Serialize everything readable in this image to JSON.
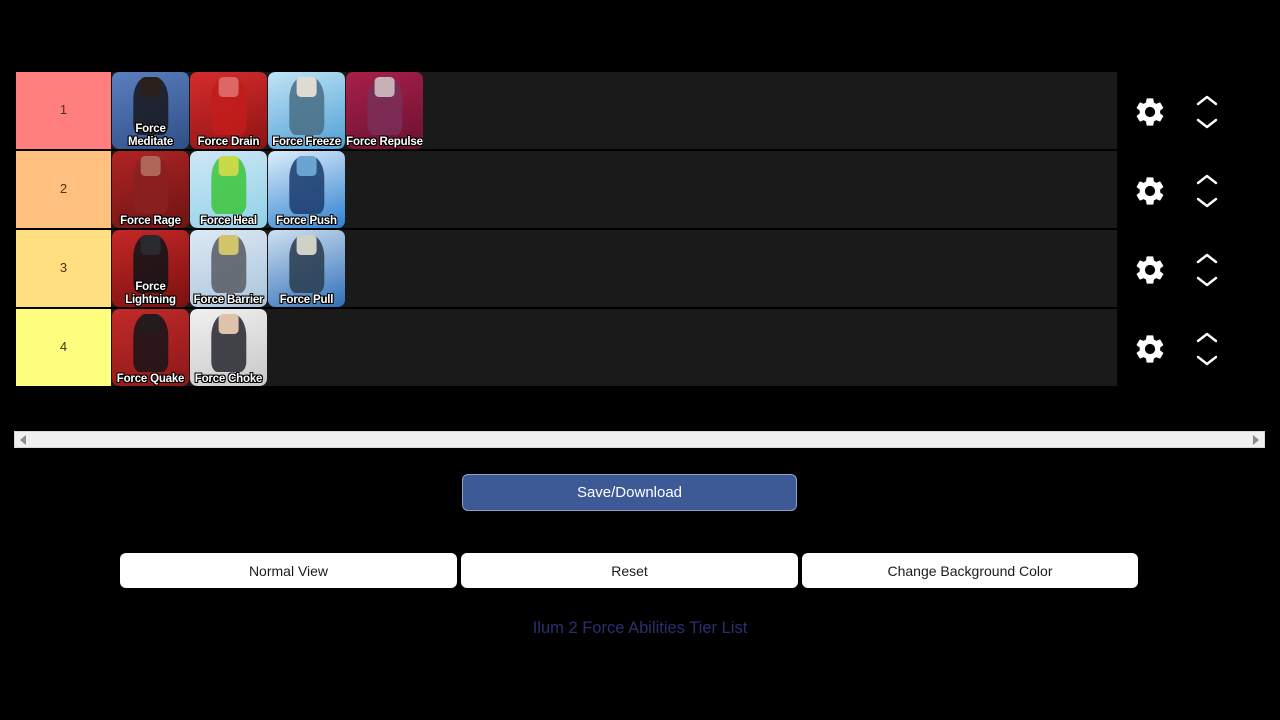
{
  "page": {
    "background_color": "#000000",
    "link_text": "Ilum 2 Force Abilities Tier List",
    "link_color": "#2b2f6e"
  },
  "tierlist": {
    "row_bg_color": "#1a1a1a",
    "rows": [
      {
        "label": "1",
        "label_color": "#FF7F7F",
        "gear_icon": "gear-icon",
        "move_up_icon": "chevron-up-icon",
        "move_down_icon": "chevron-down-icon",
        "items": [
          {
            "name": "Force Meditate",
            "bg_from": "#5b7fbf",
            "bg_to": "#2f4f86",
            "figure_color": "#191a22",
            "head_color": "#2a2118"
          },
          {
            "name": "Force Drain",
            "bg_from": "#d62c2c",
            "bg_to": "#8e1414",
            "figure_color": "#c21c1c",
            "head_color": "#e06a6a"
          },
          {
            "name": "Force Freeze",
            "bg_from": "#bfe4f5",
            "bg_to": "#4f9fd6",
            "figure_color": "#4a6f86",
            "head_color": "#e8e0d4"
          },
          {
            "name": "Force Repulse",
            "bg_from": "#a8204a",
            "bg_to": "#6c1030",
            "figure_color": "#7a2f57",
            "head_color": "#cbb9bd"
          }
        ]
      },
      {
        "label": "2",
        "label_color": "#FFBF7F",
        "gear_icon": "gear-icon",
        "move_up_icon": "chevron-up-icon",
        "move_down_icon": "chevron-down-icon",
        "items": [
          {
            "name": "Force Rage",
            "bg_from": "#b02424",
            "bg_to": "#6d1414",
            "figure_color": "#8a2020",
            "head_color": "#b06a5c"
          },
          {
            "name": "Force Heal",
            "bg_from": "#cfe7f7",
            "bg_to": "#8fd1e8",
            "figure_color": "#3fc63f",
            "head_color": "#cfd94a"
          },
          {
            "name": "Force Push",
            "bg_from": "#dceefb",
            "bg_to": "#2f7fd0",
            "figure_color": "#1d3f6e",
            "head_color": "#6fa8d8"
          }
        ]
      },
      {
        "label": "3",
        "label_color": "#FFDF7F",
        "gear_icon": "gear-icon",
        "move_up_icon": "chevron-up-icon",
        "move_down_icon": "chevron-down-icon",
        "items": [
          {
            "name": "Force Lightning",
            "bg_from": "#c62828",
            "bg_to": "#7a1010",
            "figure_color": "#131318",
            "head_color": "#2a2a30"
          },
          {
            "name": "Force Barrier",
            "bg_from": "#dde9f5",
            "bg_to": "#aac4dc",
            "figure_color": "#5a5f66",
            "head_color": "#d8c86a"
          },
          {
            "name": "Force Pull",
            "bg_from": "#cfe0f0",
            "bg_to": "#2f6fb8",
            "figure_color": "#2a3f52",
            "head_color": "#d9d9cc"
          }
        ]
      },
      {
        "label": "4",
        "label_color": "#FFFF7F",
        "gear_icon": "gear-icon",
        "move_up_icon": "chevron-up-icon",
        "move_down_icon": "chevron-down-icon",
        "items": [
          {
            "name": "Force Quake",
            "bg_from": "#c22a2a",
            "bg_to": "#8c1818",
            "figure_color": "#1a1418",
            "head_color": "#241b1e"
          },
          {
            "name": "Force Choke",
            "bg_from": "#f0f0f0",
            "bg_to": "#c8c8c8",
            "figure_color": "#2b2b33",
            "head_color": "#e8c9b0"
          }
        ]
      }
    ]
  },
  "scrollbar": {
    "left_arrow_icon": "scroll-left-arrow-icon",
    "right_arrow_icon": "scroll-right-arrow-icon"
  },
  "actions": {
    "save_label": "Save/Download",
    "normal_view_label": "Normal View",
    "reset_label": "Reset",
    "change_background_label": "Change Background Color"
  }
}
